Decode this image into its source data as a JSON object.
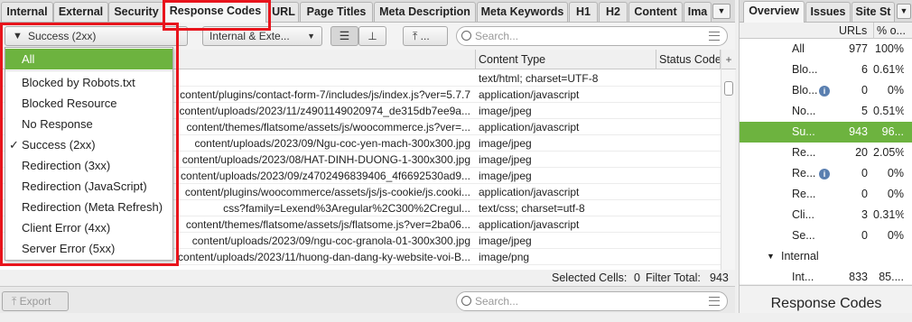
{
  "tabs": [
    "Internal",
    "External",
    "Security",
    "Response Codes",
    "URL",
    "Page Titles",
    "Meta Description",
    "Meta Keywords",
    "H1",
    "H2",
    "Content",
    "Ima"
  ],
  "toolbar": {
    "filter_label": "Success (2xx)",
    "scope_label": "Internal & Exte...",
    "export_label": "...",
    "search_placeholder": "Search..."
  },
  "dropdown": {
    "items": [
      "All",
      "Blocked by Robots.txt",
      "Blocked Resource",
      "No Response",
      "Success (2xx)",
      "Redirection (3xx)",
      "Redirection (JavaScript)",
      "Redirection (Meta Refresh)",
      "Client Error (4xx)",
      "Server Error (5xx)"
    ],
    "selected": "All",
    "checked": "Success (2xx)"
  },
  "table": {
    "columns": [
      "Content Type",
      "Status Code"
    ],
    "rows": [
      {
        "address": "",
        "type": "text/html; charset=UTF-8"
      },
      {
        "address": "content/plugins/contact-form-7/includes/js/index.js?ver=5.7.7",
        "type": "application/javascript"
      },
      {
        "address": "content/uploads/2023/11/z4901149020974_de315db7ee9a...",
        "type": "image/jpeg"
      },
      {
        "address": "content/themes/flatsome/assets/js/woocommerce.js?ver=...",
        "type": "application/javascript"
      },
      {
        "address": "content/uploads/2023/09/Ngu-coc-yen-mach-300x300.jpg",
        "type": "image/jpeg"
      },
      {
        "address": "content/uploads/2023/08/HAT-DINH-DUONG-1-300x300.jpg",
        "type": "image/jpeg"
      },
      {
        "address": "content/uploads/2023/09/z4702496839406_4f6692530ad9...",
        "type": "image/jpeg"
      },
      {
        "address": "content/plugins/woocommerce/assets/js/js-cookie/js.cooki...",
        "type": "application/javascript"
      },
      {
        "address": "css?family=Lexend%3Aregular%2C300%2Cregul...",
        "type": "text/css; charset=utf-8"
      },
      {
        "address": "content/themes/flatsome/assets/js/flatsome.js?ver=2ba06...",
        "type": "application/javascript"
      },
      {
        "address": "content/uploads/2023/09/ngu-coc-granola-01-300x300.jpg",
        "type": "image/jpeg"
      },
      {
        "address": "content/uploads/2023/11/huong-dan-dang-ky-website-voi-B...",
        "type": "image/png"
      }
    ]
  },
  "status": {
    "selected_cells_label": "Selected Cells:",
    "selected_cells": "0",
    "filter_total_label": "Filter Total:",
    "filter_total": "943"
  },
  "bottom": {
    "export_label": "Export",
    "search_placeholder": "Search..."
  },
  "right": {
    "tabs": [
      "Overview",
      "Issues",
      "Site St"
    ],
    "col_urls": "URLs",
    "col_pct": "% o...",
    "rows": [
      {
        "label": "All",
        "urls": "977",
        "pct": "100%"
      },
      {
        "label": "Blo...",
        "urls": "6",
        "pct": "0.61%"
      },
      {
        "label": "Blo...",
        "urls": "0",
        "pct": "0%"
      },
      {
        "label": "No...",
        "urls": "5",
        "pct": "0.51%"
      },
      {
        "label": "Su...",
        "urls": "943",
        "pct": "96..."
      },
      {
        "label": "Re...",
        "urls": "20",
        "pct": "2.05%"
      },
      {
        "label": "Re...",
        "urls": "0",
        "pct": "0%"
      },
      {
        "label": "Re...",
        "urls": "0",
        "pct": "0%"
      },
      {
        "label": "Cli...",
        "urls": "3",
        "pct": "0.31%"
      },
      {
        "label": "Se...",
        "urls": "0",
        "pct": "0%"
      }
    ],
    "section_label": "Internal",
    "internal_row": {
      "label": "Int...",
      "urls": "833",
      "pct": "85...."
    },
    "bottom_title": "Response Codes"
  },
  "colors": {
    "selection": "#6db33f",
    "highlight": "#e8141c"
  }
}
